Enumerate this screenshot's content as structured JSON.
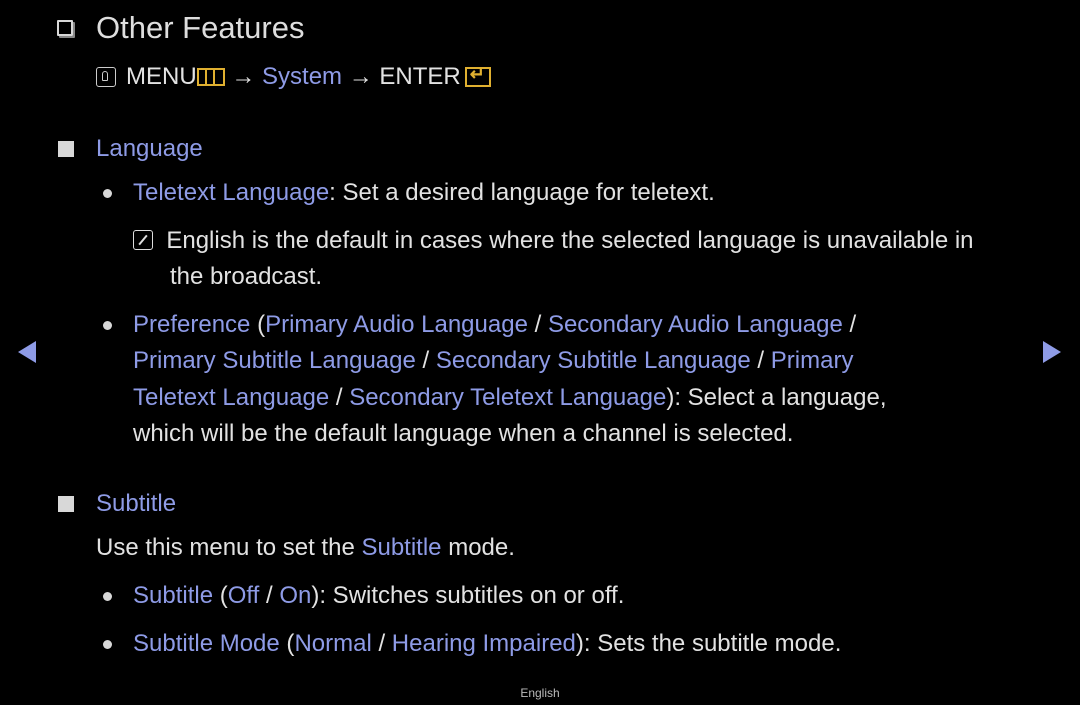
{
  "title": "Other Features",
  "path": {
    "menu": "MENU",
    "arrow1": " → ",
    "system": "System",
    "arrow2": " → ",
    "enter": "ENTER"
  },
  "language": {
    "heading": "Language",
    "teletext": {
      "term": "Teletext Language",
      "desc": ": Set a desired language for teletext."
    },
    "note": {
      "line1": "English is the default in cases where the selected language is unavailable in",
      "line2": "the broadcast."
    },
    "preference": {
      "term": "Preference",
      "open": " (",
      "opt1": "Primary Audio Language",
      "opt2": "Secondary Audio Language",
      "opt3": "Primary Subtitle Language",
      "opt4": "Secondary Subtitle Language",
      "opt5a": "Primary",
      "opt5b": "Teletext Language",
      "opt6": "Secondary Teletext Language",
      "sep": " / ",
      "close": ")",
      "desc1": ": Select a language,",
      "desc2": "which will be the default language when a channel is selected."
    }
  },
  "subtitle": {
    "heading": "Subtitle",
    "intro_pre": "Use this menu to set the ",
    "intro_term": "Subtitle",
    "intro_post": " mode.",
    "item1": {
      "term": "Subtitle",
      "open": " (",
      "opt1": "Off",
      "sep": " / ",
      "opt2": "On",
      "close": ")",
      "desc": ": Switches subtitles on or off."
    },
    "item2": {
      "term": "Subtitle Mode",
      "open": " (",
      "opt1": "Normal",
      "sep": " / ",
      "opt2": "Hearing Impaired",
      "close": ")",
      "desc": ": Sets the subtitle mode."
    }
  },
  "nav": {
    "prev": "previous-page",
    "next": "next-page"
  },
  "footer": "English"
}
